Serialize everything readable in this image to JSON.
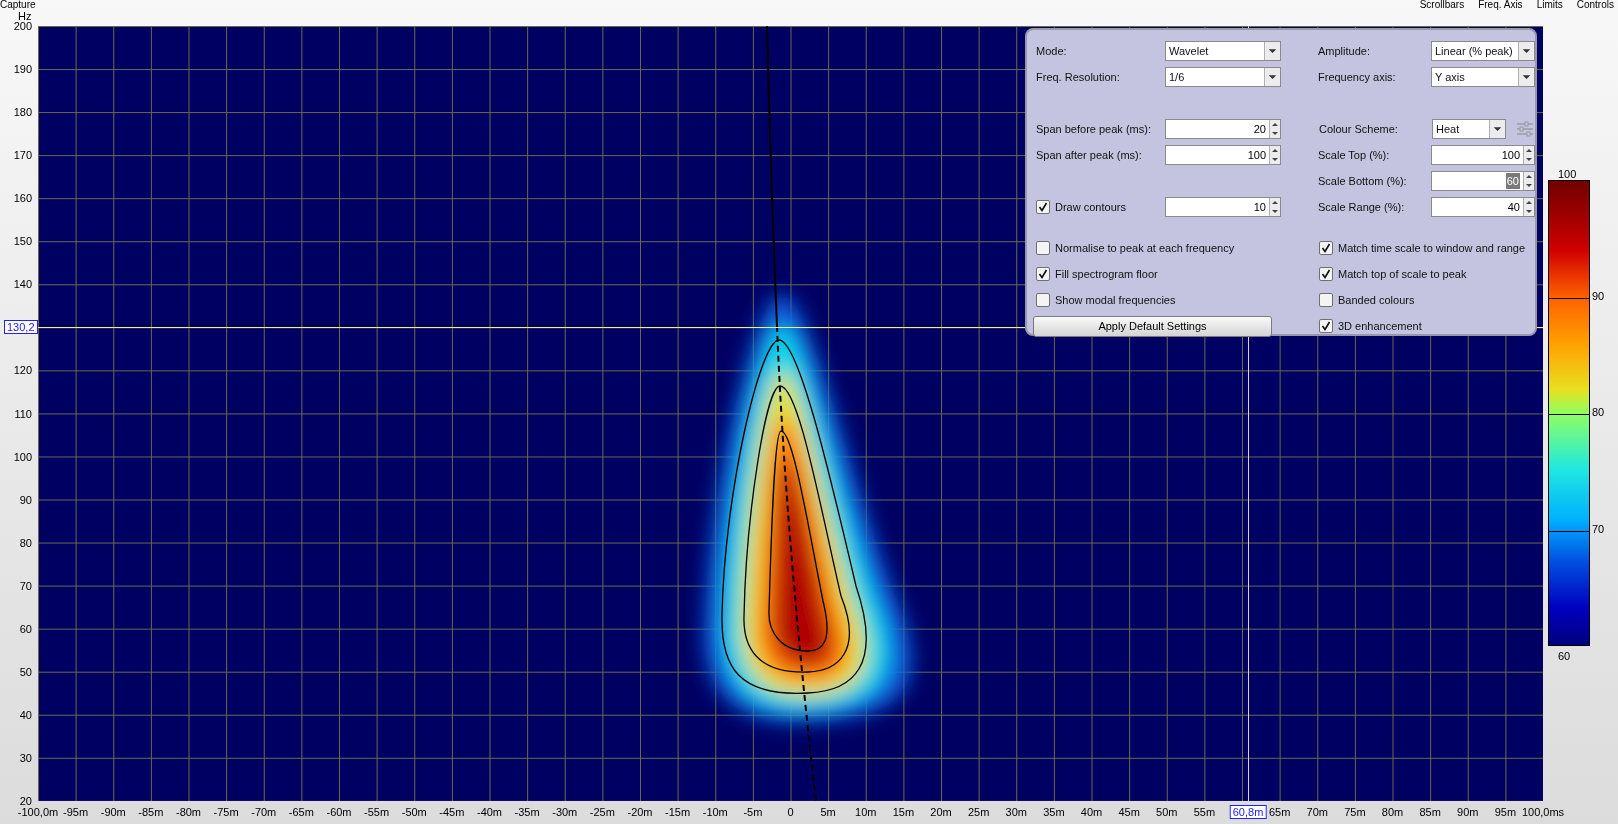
{
  "header": {
    "capture_label": "Capture",
    "menu": [
      "Scrollbars",
      "Freq. Axis",
      "Limits",
      "Controls"
    ]
  },
  "y_axis": {
    "unit": "Hz",
    "ticks_before_cursor": [
      "200",
      "190",
      "180",
      "170",
      "160",
      "150",
      "140"
    ],
    "cursor_label": "130,2",
    "ticks_after_cursor": [
      "120",
      "110",
      "100",
      "90",
      "80",
      "70",
      "60",
      "50",
      "40",
      "30",
      "20"
    ]
  },
  "x_axis": {
    "ticks_before_cursor": [
      "-100,0m",
      "-95m",
      "-90m",
      "-85m",
      "-80m",
      "-75m",
      "-70m",
      "-65m",
      "-60m",
      "-55m",
      "-50m",
      "-45m",
      "-40m",
      "-35m",
      "-30m",
      "-25m",
      "-20m",
      "-15m",
      "-10m",
      "-5m",
      "0",
      "5m",
      "10m",
      "15m",
      "20m",
      "25m",
      "30m",
      "35m",
      "40m",
      "45m",
      "50m",
      "55m"
    ],
    "cursor_label": "60,8m",
    "ticks_after_cursor": [
      "65m",
      "70m",
      "75m",
      "80m",
      "85m",
      "90m",
      "95m",
      "100,0ms"
    ]
  },
  "controls": {
    "sections": [
      {
        "rows": [
          {
            "left": {
              "kind": "dropdown",
              "label": "Mode:",
              "value": "Wavelet"
            },
            "right": {
              "kind": "dropdown",
              "label": "Amplitude:",
              "value": "Linear (% peak)"
            }
          },
          {
            "left": {
              "kind": "dropdown",
              "label": "Freq. Resolution:",
              "value": "1/6"
            },
            "right": {
              "kind": "dropdown",
              "label": "Frequency axis:",
              "value": "Y axis"
            }
          }
        ]
      },
      {
        "rows": [
          {
            "left": {
              "kind": "spinner",
              "label": "Span before peak (ms):",
              "value": "20",
              "text_selected": false
            },
            "right": {
              "kind": "scheme_dropdown",
              "label": "Colour Scheme:",
              "value": "Heat"
            }
          },
          {
            "left": {
              "kind": "spinner",
              "label": "Span after peak (ms):",
              "value": "100",
              "text_selected": false
            },
            "right": {
              "kind": "spinner",
              "label": "Scale Top (%):",
              "value": "100",
              "text_selected": false
            }
          },
          {
            "right": {
              "kind": "spinner",
              "label": "Scale Bottom (%):",
              "value": "60",
              "text_selected": true
            }
          },
          {
            "left": {
              "kind": "check_spinner",
              "label": "Draw contours",
              "checked": true,
              "value": "10",
              "text_selected": false
            },
            "right": {
              "kind": "spinner",
              "label": "Scale Range (%):",
              "value": "40",
              "text_selected": false
            }
          }
        ]
      },
      {
        "rows": [
          {
            "left": {
              "kind": "checkbox",
              "label": "Normalise to peak at each frequency",
              "checked": false
            },
            "right": {
              "kind": "checkbox",
              "label": "Match time scale to window and range",
              "checked": true
            }
          },
          {
            "left": {
              "kind": "checkbox",
              "label": "Fill spectrogram floor",
              "checked": true
            },
            "right": {
              "kind": "checkbox",
              "label": "Match top of scale to peak",
              "checked": true
            }
          },
          {
            "left": {
              "kind": "checkbox",
              "label": "Show modal frequencies",
              "checked": false
            },
            "right": {
              "kind": "checkbox",
              "label": "Banded colours",
              "checked": false
            }
          },
          {
            "left": {
              "kind": "button",
              "label": "Apply Default Settings"
            },
            "right": {
              "kind": "checkbox",
              "label": "3D enhancement",
              "checked": true
            }
          }
        ]
      }
    ]
  },
  "colour_scale": {
    "labels": [
      "100",
      "90",
      "80",
      "70",
      "60"
    ]
  }
}
